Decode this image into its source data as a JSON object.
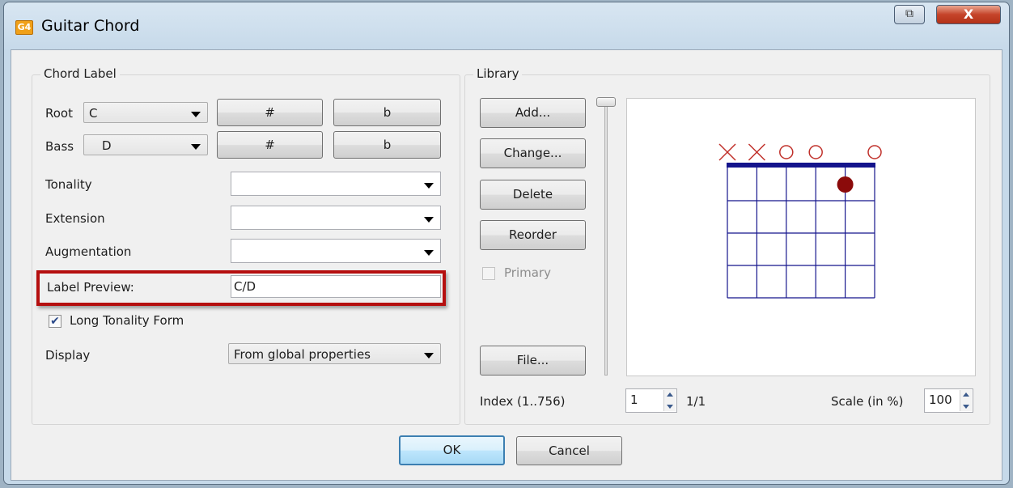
{
  "window": {
    "title": "Guitar Chord",
    "app_icon_text": "G4"
  },
  "chord_label": {
    "group_title": "Chord Label",
    "root": {
      "label": "Root",
      "value": "C",
      "sharp": "#",
      "flat": "b"
    },
    "bass": {
      "label": "Bass",
      "value": "D",
      "sharp": "#",
      "flat": "b"
    },
    "tonality": {
      "label": "Tonality",
      "value": ""
    },
    "extension": {
      "label": "Extension",
      "value": ""
    },
    "augmentation": {
      "label": "Augmentation",
      "value": ""
    },
    "label_preview": {
      "label": "Label Preview:",
      "value": "C/D"
    },
    "long_tonality": {
      "label": "Long Tonality Form",
      "checked": true
    },
    "display": {
      "label": "Display",
      "value": "From global properties"
    }
  },
  "library": {
    "group_title": "Library",
    "buttons": {
      "add": "Add...",
      "change": "Change...",
      "delete": "Delete",
      "reorder": "Reorder",
      "file": "File..."
    },
    "primary": {
      "label": "Primary",
      "checked": false,
      "enabled": false
    },
    "index": {
      "label": "Index (1..756)",
      "value": "1",
      "count": "1/1"
    },
    "scale": {
      "label": "Scale (in %)",
      "value": "100"
    },
    "diagram": {
      "strings": 6,
      "frets": 4,
      "string_markers": [
        "x",
        "x",
        "o",
        "o",
        "",
        "o"
      ],
      "dots": [
        {
          "string": 5,
          "fret": 1
        }
      ],
      "colors": {
        "grid": "#14148c",
        "marker": "#c0302a",
        "dot": "#8b0a0a"
      }
    }
  },
  "dialog_buttons": {
    "ok": "OK",
    "cancel": "Cancel"
  },
  "colors": {
    "highlight": "#b50f0f",
    "ok_border": "#3c7fb1"
  }
}
